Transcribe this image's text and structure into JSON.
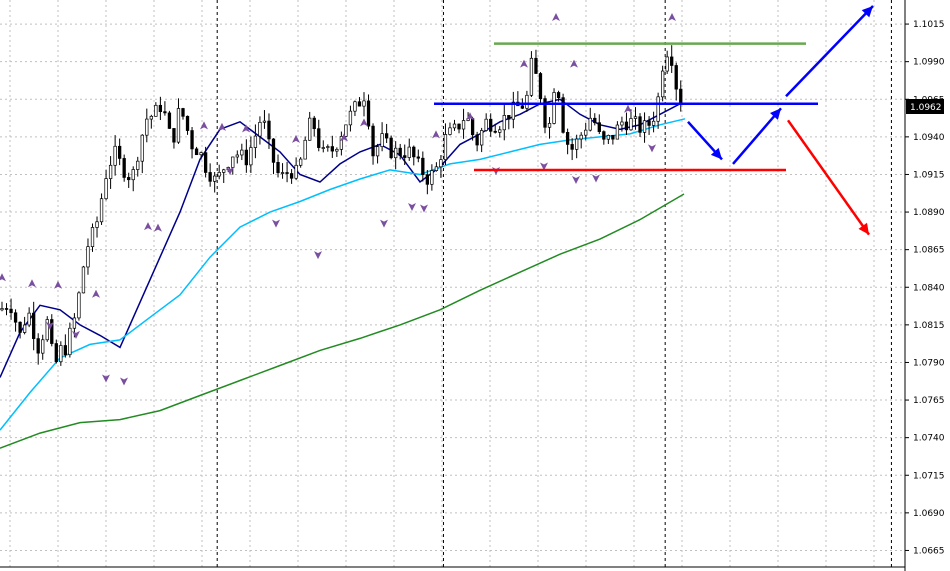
{
  "chart_data": {
    "type": "candlestick",
    "price_axis": {
      "ylim": [
        1.0654,
        1.1031
      ],
      "ticks": [
        "1.1015",
        "1.0990",
        "1.0965",
        "1.0940",
        "1.0915",
        "1.0890",
        "1.0865",
        "1.0840",
        "1.0815",
        "1.0790",
        "1.0765",
        "1.0740",
        "1.0715",
        "1.0690",
        "1.0665"
      ],
      "current_price_label": "1.0962",
      "current_price": 1.0962,
      "grid": true
    },
    "time_axis": {
      "bars_shown": 200,
      "period_separators_at_bar": [
        48,
        98,
        147,
        197
      ]
    },
    "candles": {
      "bull_color": "#ffffff",
      "bear_color": "#000000",
      "path": [
        [
          0,
          1.0825
        ],
        [
          10,
          1.083
        ],
        [
          20,
          1.0808
        ],
        [
          28,
          1.0825
        ],
        [
          38,
          1.08
        ],
        [
          48,
          1.0818
        ],
        [
          54,
          1.0785
        ],
        [
          60,
          1.0798
        ],
        [
          66,
          1.08
        ],
        [
          76,
          1.0822
        ],
        [
          86,
          1.0865
        ],
        [
          96,
          1.088
        ],
        [
          106,
          1.0915
        ],
        [
          114,
          1.093
        ],
        [
          122,
          1.092
        ],
        [
          132,
          1.0912
        ],
        [
          138,
          1.093
        ],
        [
          146,
          1.0952
        ],
        [
          154,
          1.0955
        ],
        [
          162,
          1.0962
        ],
        [
          172,
          1.0935
        ],
        [
          180,
          1.096
        ],
        [
          192,
          1.0935
        ],
        [
          200,
          1.093
        ],
        [
          206,
          1.092
        ],
        [
          216,
          1.091
        ],
        [
          224,
          1.092
        ],
        [
          234,
          1.093
        ],
        [
          246,
          1.0925
        ],
        [
          254,
          1.0938
        ],
        [
          262,
          1.0955
        ],
        [
          270,
          1.093
        ],
        [
          280,
          1.0912
        ],
        [
          290,
          1.0918
        ],
        [
          298,
          1.0915
        ],
        [
          306,
          1.094
        ],
        [
          312,
          1.0952
        ],
        [
          322,
          1.0928
        ],
        [
          334,
          1.0932
        ],
        [
          346,
          1.095
        ],
        [
          358,
          1.0962
        ],
        [
          366,
          1.097
        ],
        [
          372,
          1.0928
        ],
        [
          382,
          1.0938
        ],
        [
          392,
          1.093
        ],
        [
          400,
          1.093
        ],
        [
          410,
          1.093
        ],
        [
          418,
          1.0921
        ],
        [
          428,
          1.0912
        ],
        [
          436,
          1.0918
        ],
        [
          446,
          1.094
        ],
        [
          456,
          1.0945
        ],
        [
          466,
          1.0955
        ],
        [
          476,
          1.0935
        ],
        [
          486,
          1.095
        ],
        [
          498,
          1.0948
        ],
        [
          508,
          1.0955
        ],
        [
          518,
          1.096
        ],
        [
          526,
          1.0962
        ],
        [
          532,
          1.099
        ],
        [
          540,
          1.097
        ],
        [
          548,
          1.094
        ],
        [
          556,
          1.0985
        ],
        [
          562,
          1.095
        ],
        [
          570,
          1.093
        ],
        [
          580,
          1.094
        ],
        [
          592,
          1.0955
        ],
        [
          602,
          1.0935
        ],
        [
          612,
          1.094
        ],
        [
          622,
          1.095
        ],
        [
          632,
          1.095
        ],
        [
          642,
          1.0945
        ],
        [
          652,
          1.095
        ],
        [
          658,
          1.0965
        ],
        [
          664,
          1.0995
        ],
        [
          670,
          1.1
        ],
        [
          676,
          1.0975
        ],
        [
          682,
          1.0962
        ]
      ]
    },
    "moving_averages": [
      {
        "color": "#00008b",
        "points": [
          [
            0,
            1.078
          ],
          [
            20,
            1.081
          ],
          [
            40,
            1.0828
          ],
          [
            60,
            1.0825
          ],
          [
            80,
            1.0815
          ],
          [
            100,
            1.0808
          ],
          [
            120,
            1.08
          ],
          [
            140,
            1.083
          ],
          [
            160,
            1.086
          ],
          [
            180,
            1.089
          ],
          [
            200,
            1.0925
          ],
          [
            220,
            1.0945
          ],
          [
            240,
            1.095
          ],
          [
            260,
            1.094
          ],
          [
            280,
            1.093
          ],
          [
            300,
            1.0915
          ],
          [
            320,
            1.091
          ],
          [
            340,
            1.0922
          ],
          [
            360,
            1.093
          ],
          [
            380,
            1.0935
          ],
          [
            400,
            1.0928
          ],
          [
            420,
            1.091
          ],
          [
            440,
            1.092
          ],
          [
            460,
            1.0935
          ],
          [
            480,
            1.0942
          ],
          [
            500,
            1.095
          ],
          [
            520,
            1.0955
          ],
          [
            540,
            1.0962
          ],
          [
            560,
            1.0965
          ],
          [
            580,
            1.0955
          ],
          [
            600,
            1.0948
          ],
          [
            620,
            1.0945
          ],
          [
            640,
            1.0948
          ],
          [
            660,
            1.0955
          ],
          [
            680,
            1.0962
          ]
        ]
      },
      {
        "color": "#00bfff",
        "points": [
          [
            0,
            1.0745
          ],
          [
            30,
            1.077
          ],
          [
            60,
            1.0793
          ],
          [
            90,
            1.0802
          ],
          [
            120,
            1.0805
          ],
          [
            150,
            1.082
          ],
          [
            180,
            1.0835
          ],
          [
            210,
            1.086
          ],
          [
            240,
            1.088
          ],
          [
            270,
            1.089
          ],
          [
            300,
            1.0897
          ],
          [
            330,
            1.0905
          ],
          [
            360,
            1.0912
          ],
          [
            390,
            1.0918
          ],
          [
            420,
            1.0915
          ],
          [
            450,
            1.0922
          ],
          [
            480,
            1.0925
          ],
          [
            510,
            1.093
          ],
          [
            540,
            1.0935
          ],
          [
            570,
            1.0938
          ],
          [
            600,
            1.094
          ],
          [
            630,
            1.0942
          ],
          [
            660,
            1.0948
          ],
          [
            685,
            1.0952
          ]
        ]
      },
      {
        "color": "#228b22",
        "points": [
          [
            0,
            1.0733
          ],
          [
            40,
            1.0743
          ],
          [
            80,
            1.075
          ],
          [
            120,
            1.0752
          ],
          [
            160,
            1.0758
          ],
          [
            200,
            1.0768
          ],
          [
            240,
            1.0778
          ],
          [
            280,
            1.0788
          ],
          [
            320,
            1.0798
          ],
          [
            360,
            1.0806
          ],
          [
            400,
            1.0815
          ],
          [
            440,
            1.0825
          ],
          [
            480,
            1.0838
          ],
          [
            520,
            1.085
          ],
          [
            560,
            1.0862
          ],
          [
            600,
            1.0872
          ],
          [
            640,
            1.0885
          ],
          [
            684,
            1.0902
          ]
        ]
      }
    ],
    "fractals": {
      "color": "#7b4fa0",
      "up": [
        [
          2,
          1.0846
        ],
        [
          32,
          1.0842
        ],
        [
          58,
          1.0841
        ],
        [
          96,
          1.0835
        ],
        [
          148,
          1.088
        ],
        [
          158,
          1.0879
        ],
        [
          204,
          1.0947
        ],
        [
          222,
          1.0946
        ],
        [
          246,
          1.0945
        ],
        [
          296,
          1.0938
        ],
        [
          344,
          1.0939
        ],
        [
          364,
          1.0949
        ],
        [
          436,
          1.0941
        ],
        [
          470,
          1.0953
        ],
        [
          524,
          1.0988
        ],
        [
          556,
          1.1019
        ],
        [
          574,
          1.0988
        ],
        [
          628,
          1.0958
        ],
        [
          672,
          1.1019
        ]
      ],
      "down": [
        [
          50,
          1.0815
        ],
        [
          76,
          1.0809
        ],
        [
          106,
          1.078
        ],
        [
          124,
          1.0778
        ],
        [
          230,
          1.0918
        ],
        [
          276,
          1.0883
        ],
        [
          318,
          1.0862
        ],
        [
          384,
          1.0883
        ],
        [
          412,
          1.0894
        ],
        [
          424,
          1.0893
        ],
        [
          496,
          1.0918
        ],
        [
          544,
          1.0921
        ],
        [
          576,
          1.0912
        ],
        [
          596,
          1.0913
        ],
        [
          652,
          1.0933
        ]
      ]
    },
    "levels": [
      {
        "color": "#6aa84f",
        "price": 1.1002,
        "from_x": 494,
        "to_x": 806
      },
      {
        "color": "#0000ff",
        "price": 1.0962,
        "from_x": 434,
        "to_x": 818
      },
      {
        "color": "#ff0000",
        "price": 1.0918,
        "from_x": 474,
        "to_x": 786
      }
    ],
    "arrows": [
      {
        "color": "#0000ff",
        "from": [
          688,
          1.095
        ],
        "to": [
          722,
          1.0925
        ]
      },
      {
        "color": "#0000ff",
        "from": [
          733,
          1.0922
        ],
        "to": [
          781,
          1.0959
        ]
      },
      {
        "color": "#0000ff",
        "from": [
          786,
          1.0967
        ],
        "to": [
          873,
          1.1027
        ]
      },
      {
        "color": "#ff0000",
        "from": [
          788,
          1.0951
        ],
        "to": [
          869,
          1.0875
        ]
      }
    ]
  }
}
